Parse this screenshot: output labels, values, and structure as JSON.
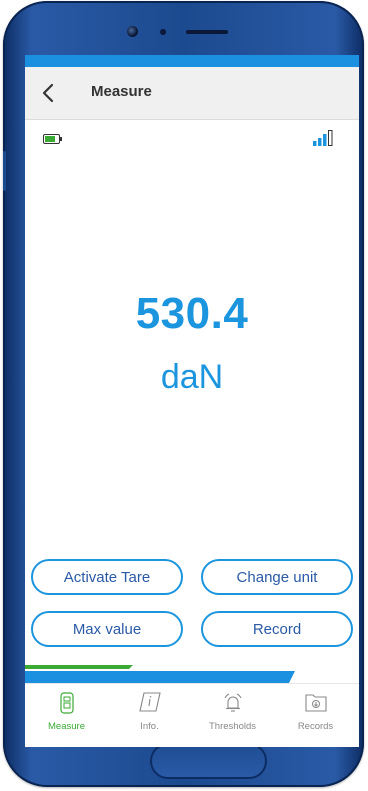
{
  "header": {
    "title": "Measure"
  },
  "reading": {
    "value": "530.4",
    "unit": "daN"
  },
  "status": {
    "battery_icon": "battery-icon",
    "signal_icon": "signal-strength-icon"
  },
  "buttons": {
    "activate_tare": "Activate Tare",
    "change_unit": "Change unit",
    "max_value": "Max value",
    "record": "Record"
  },
  "tabs": [
    {
      "label": "Measure",
      "icon": "measure-icon",
      "active": true
    },
    {
      "label": "Info.",
      "icon": "info-icon",
      "active": false
    },
    {
      "label": "Thresholds",
      "icon": "thresholds-bell-icon",
      "active": false
    },
    {
      "label": "Records",
      "icon": "records-icon",
      "active": false
    }
  ],
  "colors": {
    "accent_blue": "#1b95de",
    "accent_green": "#3aaa35",
    "phone_frame": "#1c4a8f"
  }
}
